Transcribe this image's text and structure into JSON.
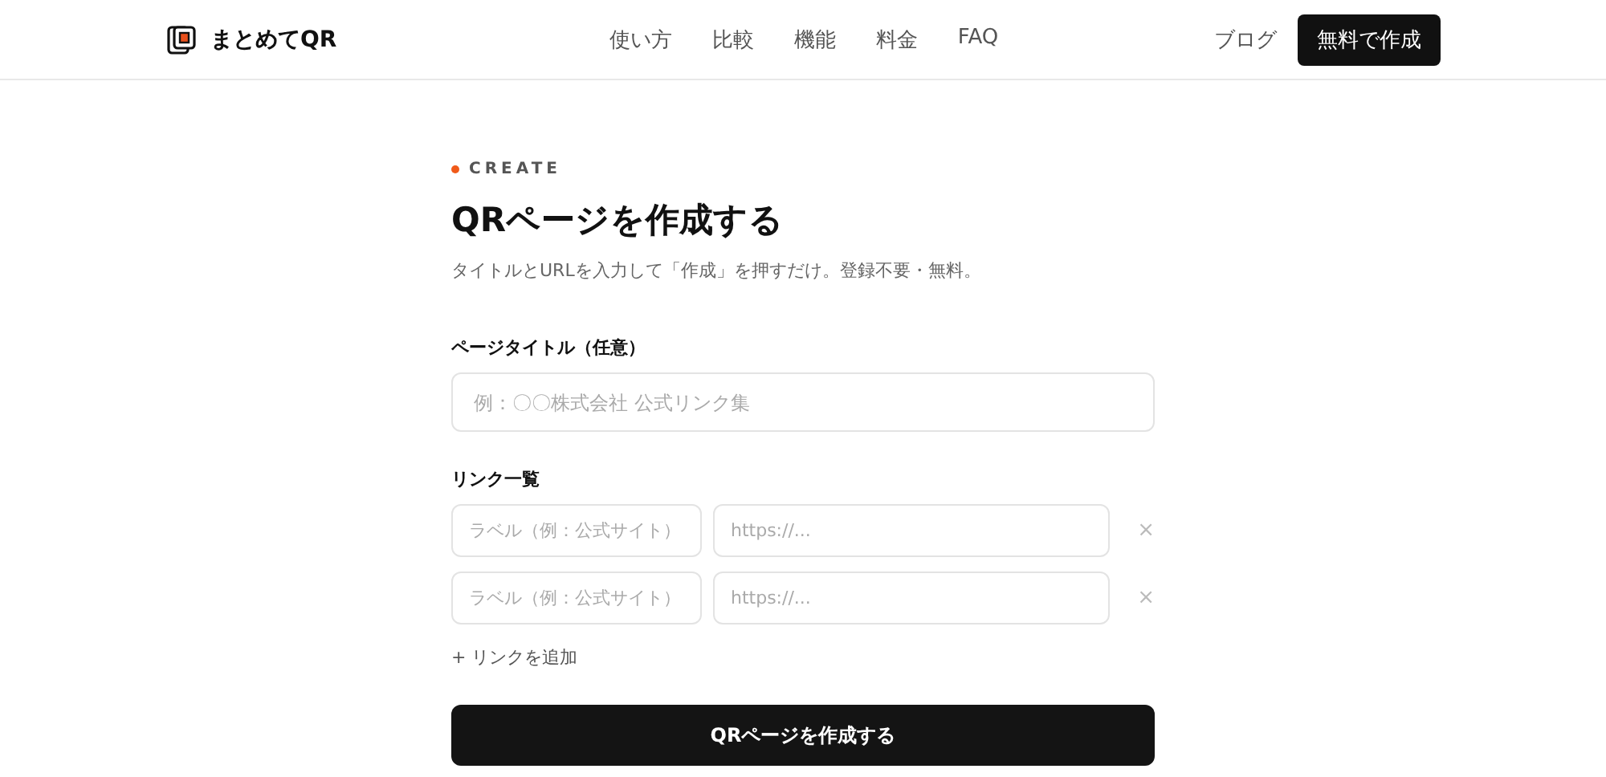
{
  "header": {
    "brand": "まとめてQR",
    "nav": [
      "使い方",
      "比較",
      "機能",
      "料金",
      "FAQ"
    ],
    "blog_link": "ブログ",
    "cta_button": "無料で作成"
  },
  "form": {
    "eyebrow": "CREATE",
    "title": "QRページを作成する",
    "description": "タイトルとURLを入力して「作成」を押すだけ。登録不要・無料。",
    "page_title_label": "ページタイトル（任意）",
    "page_title_placeholder": "例：〇〇株式会社 公式リンク集",
    "links_label": "リンク一覧",
    "links": [
      {
        "label_placeholder": "ラベル（例：公式サイト）",
        "url_placeholder": "https://...",
        "remove": "×"
      },
      {
        "label_placeholder": "ラベル（例：公式サイト）",
        "url_placeholder": "https://...",
        "remove": "×"
      }
    ],
    "add_link": "+ リンクを追加",
    "submit": "QRページを作成する"
  }
}
